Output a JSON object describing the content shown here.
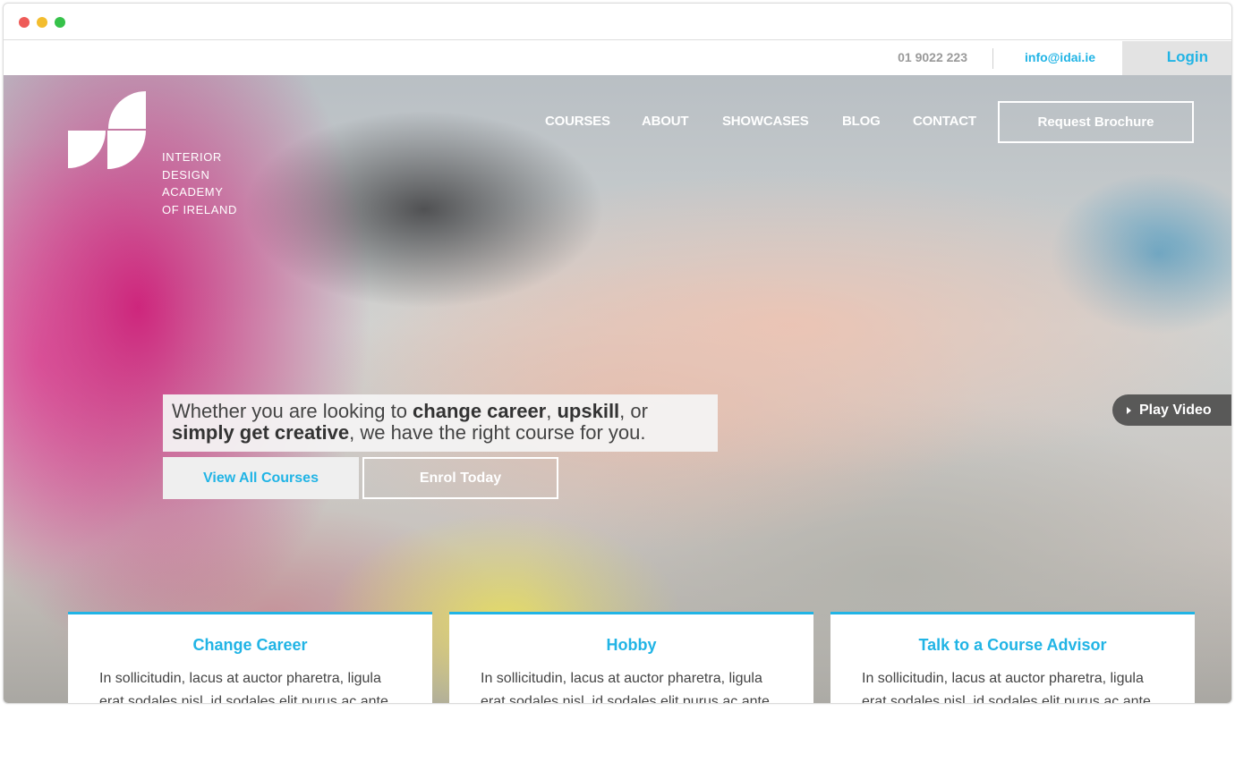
{
  "topbar": {
    "phone": "01 9022 223",
    "email": "info@idai.ie",
    "login": "Login"
  },
  "logo": {
    "lines": [
      "INTERIOR",
      "DESIGN",
      "ACADEMY",
      "OF IRELAND"
    ]
  },
  "nav": {
    "items": [
      "COURSES",
      "ABOUT",
      "SHOWCASES",
      "BLOG",
      "CONTACT"
    ],
    "brochure": "Request Brochure"
  },
  "hero": {
    "tagline": {
      "p1": "Whether you are looking to ",
      "b1": "change career",
      "p2": ", ",
      "b2": "upskill",
      "p3": ", or",
      "b3": "simply get creative",
      "p4": ", we have the right course for you."
    },
    "view_courses": "View All Courses",
    "enrol": "Enrol Today",
    "play_video": "Play Video"
  },
  "cards": [
    {
      "title": "Change Career",
      "body": "In sollicitudin, lacus at auctor pharetra, ligula erat sodales nisl, id sodales elit purus ac ante."
    },
    {
      "title": "Hobby",
      "body": "In sollicitudin, lacus at auctor pharetra, ligula erat sodales nisl, id sodales elit purus ac ante."
    },
    {
      "title": "Talk to a Course Advisor",
      "body": "In sollicitudin, lacus at auctor pharetra, ligula erat sodales nisl, id sodales elit purus ac ante."
    }
  ],
  "colors": {
    "accent": "#21b4e5",
    "text": "#444444"
  }
}
